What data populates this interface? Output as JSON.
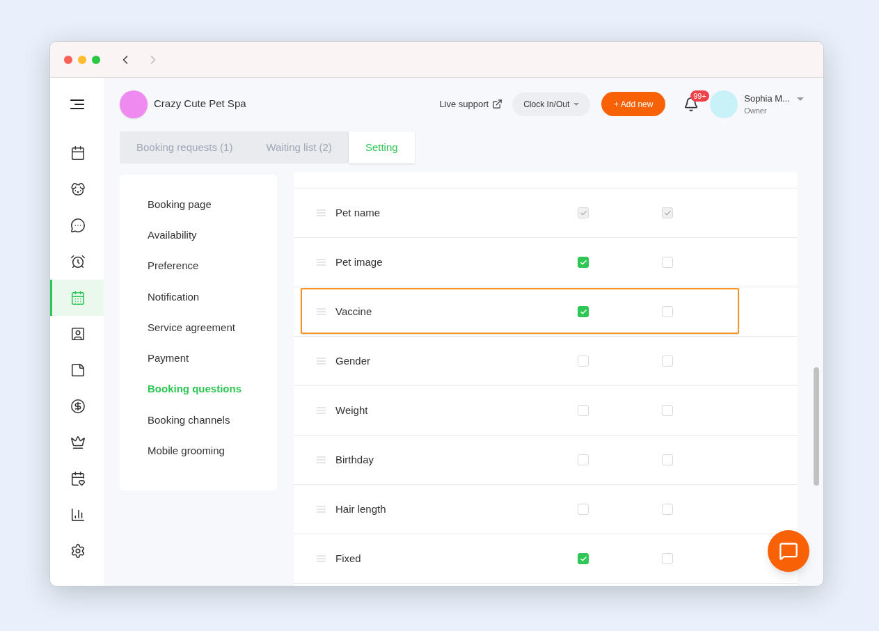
{
  "nav": {
    "back_enabled": true,
    "forward_enabled": false
  },
  "sidebar": {
    "items": [
      {
        "kind": "calendar",
        "selected": false
      },
      {
        "kind": "dog",
        "selected": false
      },
      {
        "kind": "chat",
        "selected": false
      },
      {
        "kind": "alarm",
        "selected": false
      },
      {
        "kind": "booking",
        "selected": true
      },
      {
        "kind": "badge",
        "selected": false
      },
      {
        "kind": "note",
        "selected": false
      },
      {
        "kind": "dollar",
        "selected": false
      },
      {
        "kind": "crown",
        "selected": false
      },
      {
        "kind": "heart-calendar",
        "selected": false
      },
      {
        "kind": "chart",
        "selected": false
      },
      {
        "kind": "settings",
        "selected": false
      }
    ]
  },
  "header": {
    "business_name": "Crazy Cute Pet Spa",
    "live_support": "Live support",
    "clock_button": "Clock In/Out",
    "add_button": "+ Add new",
    "notification_count": "99+",
    "user_name": "Sophia M...",
    "user_role": "Owner"
  },
  "tabs": [
    {
      "label": "Booking requests (1)",
      "selected": false
    },
    {
      "label": "Waiting list (2)",
      "selected": false
    },
    {
      "label": "Setting",
      "selected": true
    }
  ],
  "settings_menu": [
    {
      "label": "Booking page",
      "selected": false
    },
    {
      "label": "Availability",
      "selected": false
    },
    {
      "label": "Preference",
      "selected": false
    },
    {
      "label": "Notification",
      "selected": false
    },
    {
      "label": "Service agreement",
      "selected": false
    },
    {
      "label": "Payment",
      "selected": false
    },
    {
      "label": "Booking questions",
      "selected": true
    },
    {
      "label": "Booking channels",
      "selected": false
    },
    {
      "label": "Mobile grooming",
      "selected": false
    }
  ],
  "questions": [
    {
      "label": "Pet name",
      "highlighted": false,
      "column_1": {
        "checked": true,
        "disabled": true
      },
      "column_2": {
        "checked": true,
        "disabled": true
      }
    },
    {
      "label": "Pet image",
      "highlighted": false,
      "column_1": {
        "checked": true,
        "disabled": false
      },
      "column_2": {
        "checked": false,
        "disabled": false
      }
    },
    {
      "label": "Vaccine",
      "highlighted": true,
      "column_1": {
        "checked": true,
        "disabled": false
      },
      "column_2": {
        "checked": false,
        "disabled": false
      }
    },
    {
      "label": "Gender",
      "highlighted": false,
      "column_1": {
        "checked": false,
        "disabled": false
      },
      "column_2": {
        "checked": false,
        "disabled": false
      }
    },
    {
      "label": "Weight",
      "highlighted": false,
      "column_1": {
        "checked": false,
        "disabled": false
      },
      "column_2": {
        "checked": false,
        "disabled": false
      }
    },
    {
      "label": "Birthday",
      "highlighted": false,
      "column_1": {
        "checked": false,
        "disabled": false
      },
      "column_2": {
        "checked": false,
        "disabled": false
      }
    },
    {
      "label": "Hair length",
      "highlighted": false,
      "column_1": {
        "checked": false,
        "disabled": false
      },
      "column_2": {
        "checked": false,
        "disabled": false
      }
    },
    {
      "label": "Fixed",
      "highlighted": false,
      "column_1": {
        "checked": true,
        "disabled": false
      },
      "column_2": {
        "checked": false,
        "disabled": false
      }
    }
  ]
}
